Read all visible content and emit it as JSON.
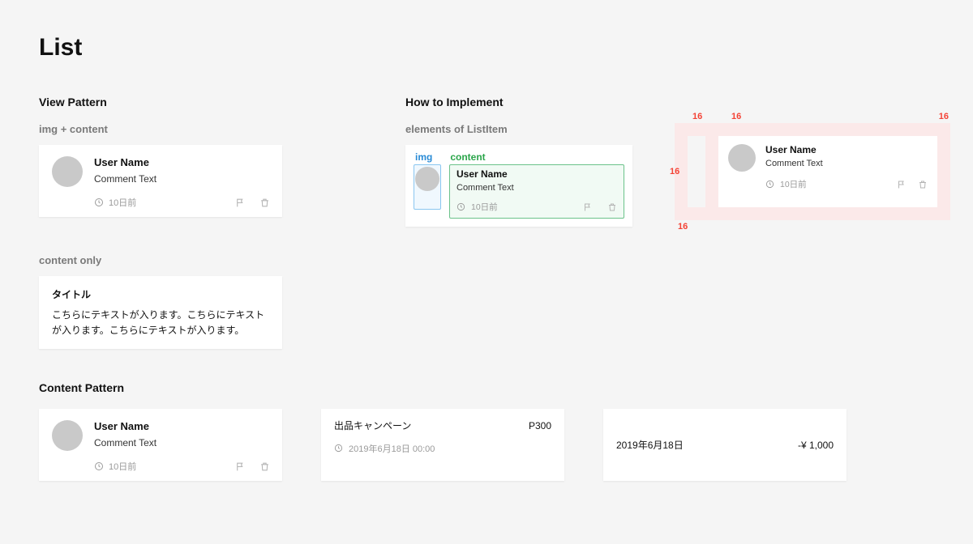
{
  "page_title": "List",
  "view_pattern": {
    "heading": "View Pattern",
    "img_content": {
      "label": "img + content",
      "user": "User Name",
      "comment": "Comment Text",
      "time": "10日前"
    },
    "content_only": {
      "label": "content only",
      "title": "タイトル",
      "body": "こちらにテキストが入ります。こちらにテキストが入ります。こちらにテキストが入ります。"
    }
  },
  "how_to_implement": {
    "heading": "How to Implement",
    "elements": {
      "label": "elements of ListItem",
      "img_label": "img",
      "content_label": "content",
      "user": "User Name",
      "comment": "Comment Text",
      "time": "10日前"
    },
    "spacing": {
      "value": "16",
      "user": "User Name",
      "comment": "Comment Text",
      "time": "10日前"
    }
  },
  "content_pattern": {
    "heading": "Content Pattern",
    "card_a": {
      "user": "User Name",
      "comment": "Comment Text",
      "time": "10日前"
    },
    "card_b": {
      "title": "出品キャンペーン",
      "points": "P300",
      "datetime": "2019年6月18日 00:00"
    },
    "card_c": {
      "date": "2019年6月18日",
      "amount": "-¥ 1,000"
    }
  },
  "icons": {
    "clock": "clock-icon",
    "flag": "flag-icon",
    "trash": "trash-icon"
  }
}
